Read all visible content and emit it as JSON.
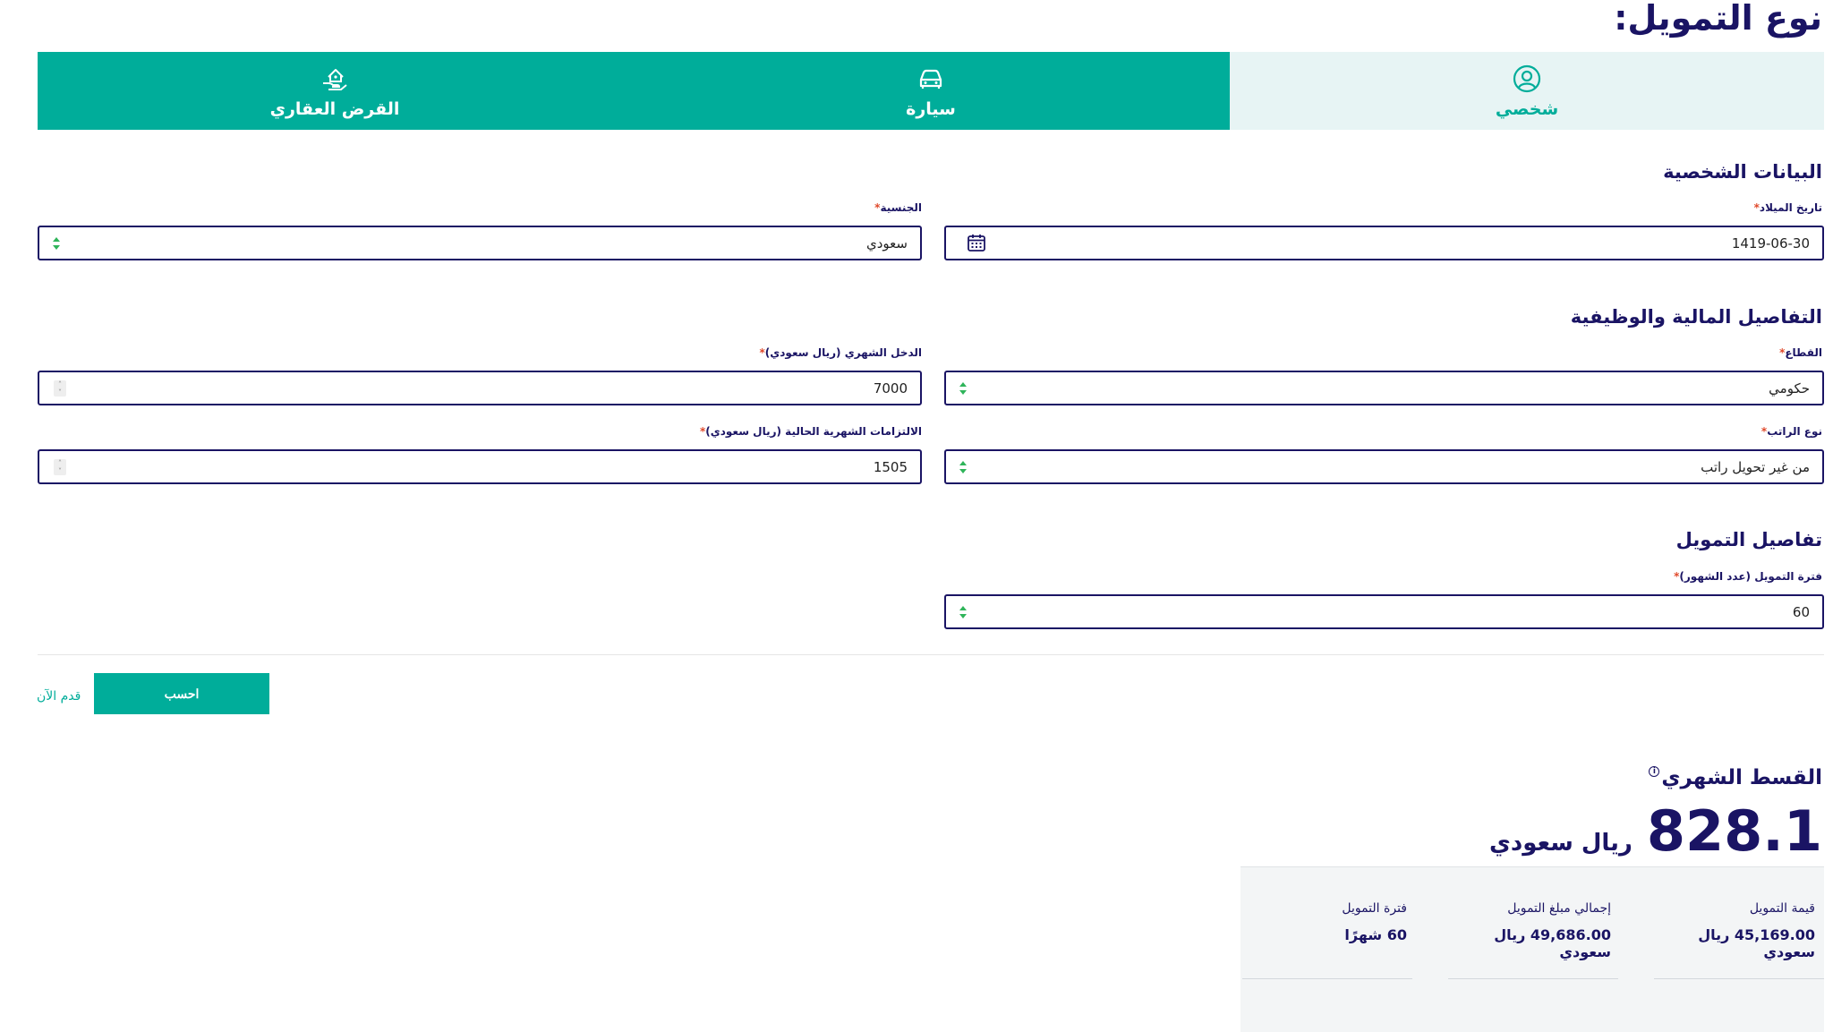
{
  "page": {
    "title": "نوع التمويل:"
  },
  "tabs": [
    {
      "label": "شخصي",
      "icon": "person-circle-icon",
      "active": true
    },
    {
      "label": "سيارة",
      "icon": "car-icon",
      "active": false
    },
    {
      "label": "القرض العقاري",
      "icon": "house-hand-icon",
      "active": false
    }
  ],
  "personal": {
    "title": "البيانات الشخصية",
    "birth_date": {
      "label": "تاريخ الميلاد",
      "value": "1419-06-30",
      "icon": "calendar-icon"
    },
    "nationality": {
      "label": "الجنسية",
      "value": "سعودي"
    }
  },
  "financial": {
    "title": "التفاصيل المالية والوظيفية",
    "sector": {
      "label": "القطاع",
      "value": "حكومي"
    },
    "monthly_income": {
      "label": "الدخل الشهري (ريال سعودي)",
      "value": "7000"
    },
    "salary_type": {
      "label": "نوع الراتب",
      "value": "من غير تحويل راتب"
    },
    "obligations": {
      "label": "الالتزامات الشهرية الحالية (ريال سعودي)",
      "value": "1505"
    }
  },
  "financing": {
    "title": "تفاصيل التمويل",
    "period": {
      "label": "فترة التمويل (عدد الشهور)",
      "value": "60"
    }
  },
  "required_mark": "*",
  "actions": {
    "calculate": "احسب",
    "apply_now": "قدم الآن"
  },
  "result": {
    "monthly_label": "القسط الشهري",
    "info_glyph": "i",
    "monthly_value": "828.1",
    "currency": "ريال سعودي",
    "summary": [
      {
        "label": "قيمة التمويل",
        "value": "45,169.00 ريال سعودي"
      },
      {
        "label": "إجمالي مبلغ التمويل",
        "value": "49,686.00 ريال سعودي"
      },
      {
        "label": "فترة التمويل",
        "value": "60 شهرًا"
      }
    ]
  },
  "colors": {
    "primary": "#00ad9a",
    "navy": "#1a1464",
    "tab_active_bg": "#e7f4f4",
    "required": "#e0492b"
  }
}
